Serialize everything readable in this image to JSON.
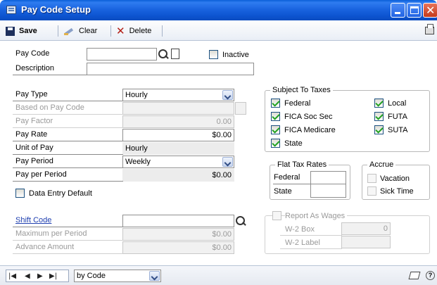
{
  "window": {
    "title": "Pay Code Setup"
  },
  "toolbar": {
    "save": "Save",
    "clear": "Clear",
    "delete": "Delete"
  },
  "form": {
    "pay_code": {
      "label": "Pay Code",
      "value": ""
    },
    "inactive": {
      "label": "Inactive",
      "checked": false
    },
    "description": {
      "label": "Description",
      "value": ""
    },
    "pay_type": {
      "label": "Pay Type",
      "value": "Hourly"
    },
    "based_on_pay_code": {
      "label": "Based on Pay Code",
      "value": ""
    },
    "pay_factor": {
      "label": "Pay Factor",
      "value": "0.00"
    },
    "pay_rate": {
      "label": "Pay Rate",
      "value": "$0.00"
    },
    "unit_of_pay": {
      "label": "Unit of Pay",
      "value": "Hourly"
    },
    "pay_period": {
      "label": "Pay Period",
      "value": "Weekly"
    },
    "pay_per_period": {
      "label": "Pay per Period",
      "value": "$0.00"
    },
    "data_entry_default": {
      "label": "Data Entry Default",
      "checked": false
    },
    "shift_code": {
      "label": "Shift Code",
      "value": ""
    },
    "maximum_per_period": {
      "label": "Maximum per Period",
      "value": "$0.00"
    },
    "advance_amount": {
      "label": "Advance Amount",
      "value": "$0.00"
    }
  },
  "taxes": {
    "title": "Subject To Taxes",
    "federal": "Federal",
    "fica_soc_sec": "FICA Soc Sec",
    "fica_medicare": "FICA Medicare",
    "state": "State",
    "local": "Local",
    "futa": "FUTA",
    "suta": "SUTA"
  },
  "flat_tax": {
    "title": "Flat Tax Rates",
    "federal": "Federal",
    "state": "State"
  },
  "accrue": {
    "title": "Accrue",
    "vacation": "Vacation",
    "sick_time": "Sick Time"
  },
  "wages": {
    "title": "Report As Wages",
    "w2_box": "W-2 Box",
    "w2_box_value": "0",
    "w2_label": "W-2 Label"
  },
  "statusbar": {
    "sort": "by Code"
  }
}
